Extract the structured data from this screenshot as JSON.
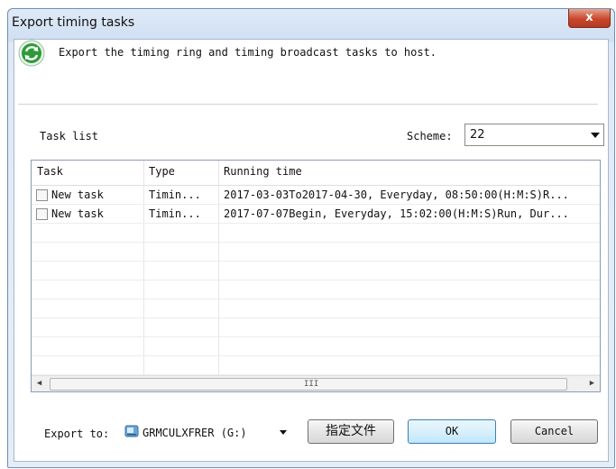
{
  "window": {
    "title": "Export timing tasks",
    "close_glyph": "x"
  },
  "header": {
    "icon": "refresh-icon",
    "text": "Export the timing ring and timing broadcast tasks to host."
  },
  "task_list": {
    "label": "Task list",
    "scheme_label": "Scheme:",
    "scheme_value": "22",
    "columns": [
      "Task",
      "Type",
      "Running time"
    ],
    "rows": [
      {
        "task": "New task",
        "type": "Timin...",
        "running_time": "2017-03-03To2017-04-30, Everyday, 08:50:00(H:M:S)R..."
      },
      {
        "task": "New task",
        "type": "Timin...",
        "running_time": "2017-07-07Begin, Everyday, 15:02:00(H:M:S)Run, Dur..."
      }
    ],
    "scroll_grip": "III"
  },
  "footer": {
    "export_label": "Export to:",
    "drive_value": "GRMCULXFRER (G:)",
    "specify_file_label": "指定文件",
    "ok_label": "OK",
    "cancel_label": "Cancel"
  },
  "colors": {
    "accent": "#3c7fb1",
    "close": "#c8472c",
    "icon_green": "#2e9b3a"
  }
}
